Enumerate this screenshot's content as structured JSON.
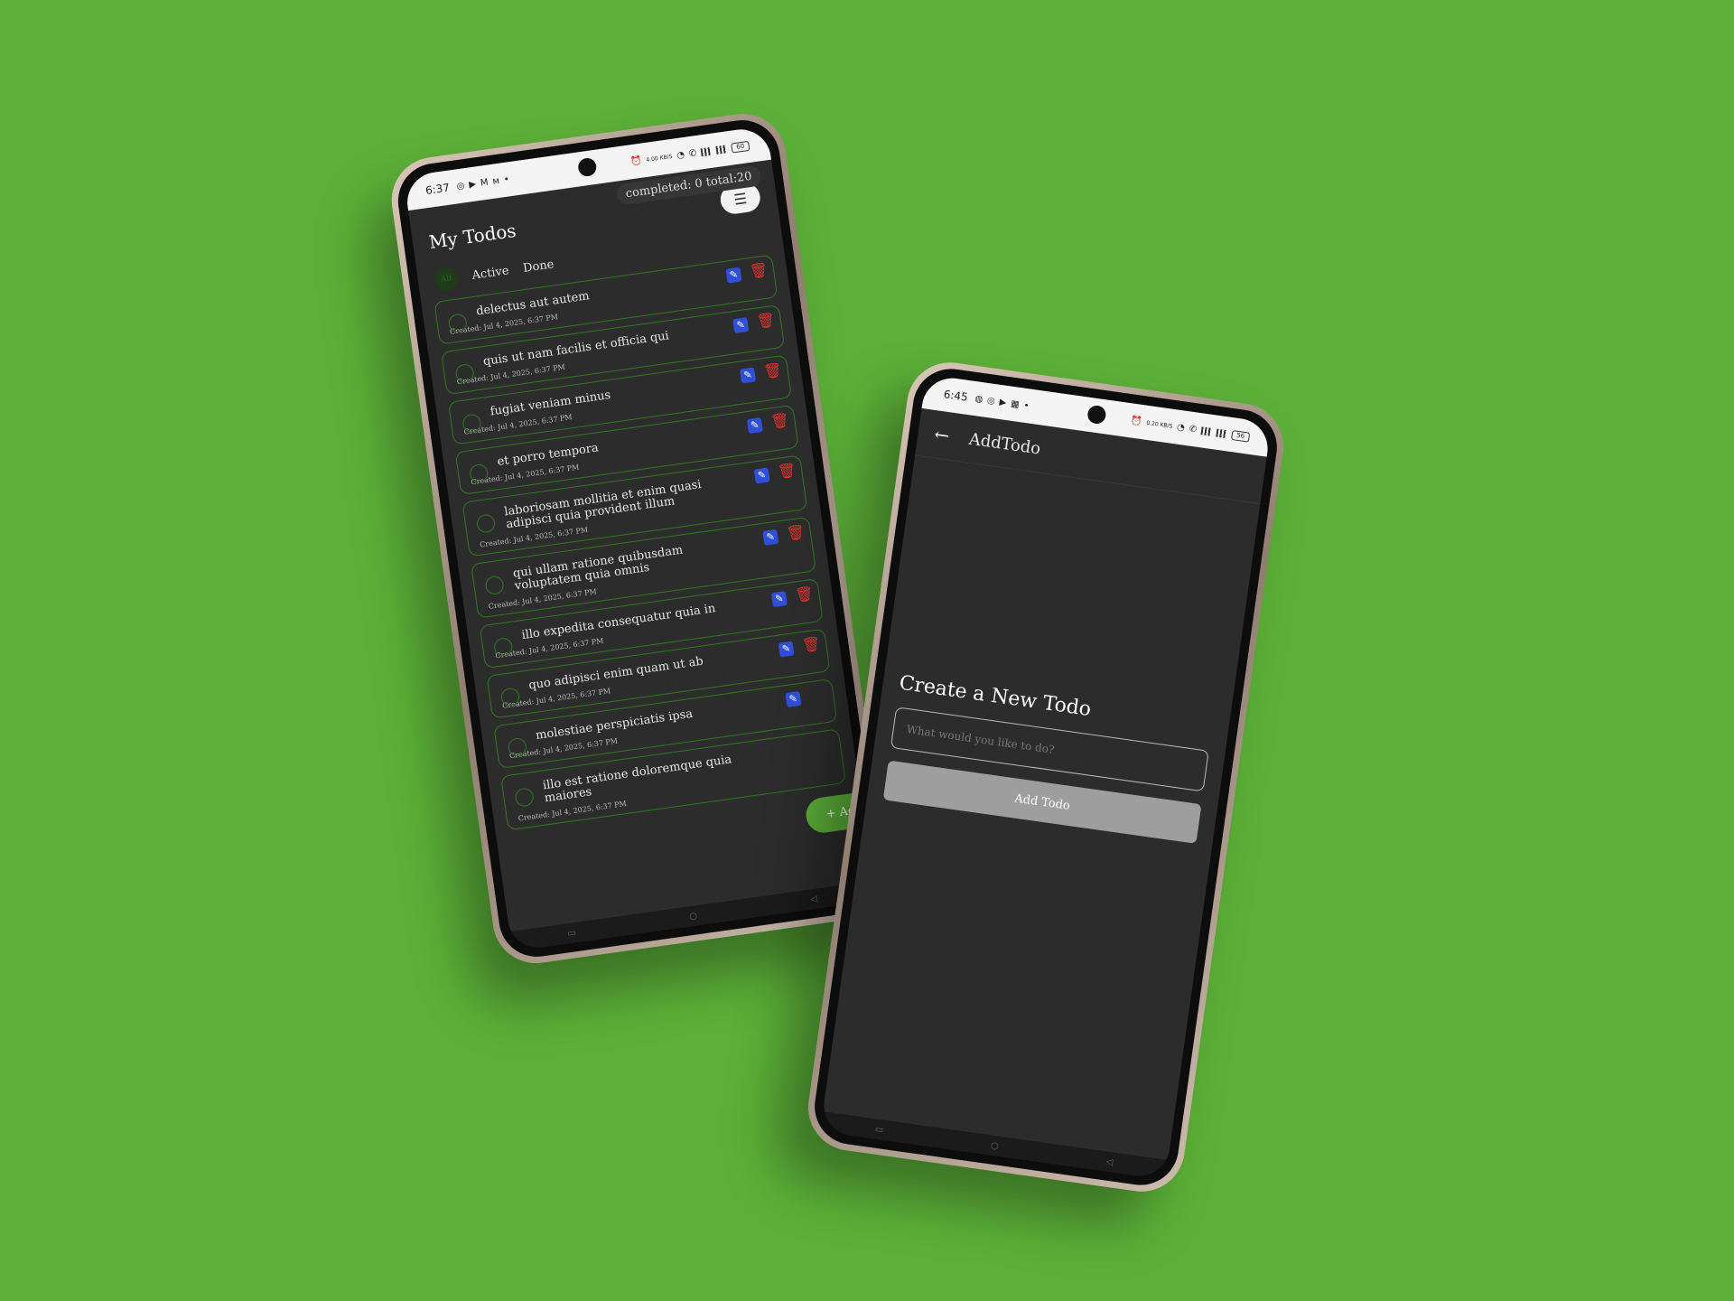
{
  "colors": {
    "background": "#5cb038",
    "screen": "#2c2c2c",
    "accent_green": "#2e7a1f",
    "edit_blue": "#2f4fd6",
    "delete_red": "#e0302c"
  },
  "phone1": {
    "status": {
      "time": "6:37",
      "speed": "4.00 KB/S",
      "battery": "60"
    },
    "completed_label": "completed: 0 total:20",
    "title": "My Todos",
    "tabs": {
      "all": "All",
      "active": "Active",
      "done": "Done"
    },
    "todos": [
      {
        "text": "delectus aut autem",
        "created": "Created: Jul 4, 2025, 6:37 PM"
      },
      {
        "text": "quis ut nam facilis et officia qui",
        "created": "Created: Jul 4, 2025, 6:37 PM"
      },
      {
        "text": "fugiat veniam minus",
        "created": "Created: Jul 4, 2025, 6:37 PM"
      },
      {
        "text": "et porro tempora",
        "created": "Created: Jul 4, 2025, 6:37 PM"
      },
      {
        "text": "laboriosam mollitia et enim quasi adipisci quia provident illum",
        "created": "Created: Jul 4, 2025, 6:37 PM"
      },
      {
        "text": "qui ullam ratione quibusdam voluptatem quia omnis",
        "created": "Created: Jul 4, 2025, 6:37 PM"
      },
      {
        "text": "illo expedita consequatur quia in",
        "created": "Created: Jul 4, 2025, 6:37 PM"
      },
      {
        "text": "quo adipisci enim quam ut ab",
        "created": "Created: Jul 4, 2025, 6:37 PM"
      },
      {
        "text": "molestiae perspiciatis ipsa",
        "created": "Created: Jul 4, 2025, 6:37 PM"
      },
      {
        "text": "illo est ratione doloremque quia maiores",
        "created": "Created: Jul 4, 2025, 6:37 PM"
      }
    ],
    "fab_label": "+ Ad"
  },
  "phone2": {
    "status": {
      "time": "6:45",
      "speed": "0.20 KB/S",
      "battery": "56"
    },
    "title": "AddTodo",
    "create_title": "Create a New Todo",
    "input_placeholder": "What would you like to do?",
    "add_button": "Add Todo"
  }
}
